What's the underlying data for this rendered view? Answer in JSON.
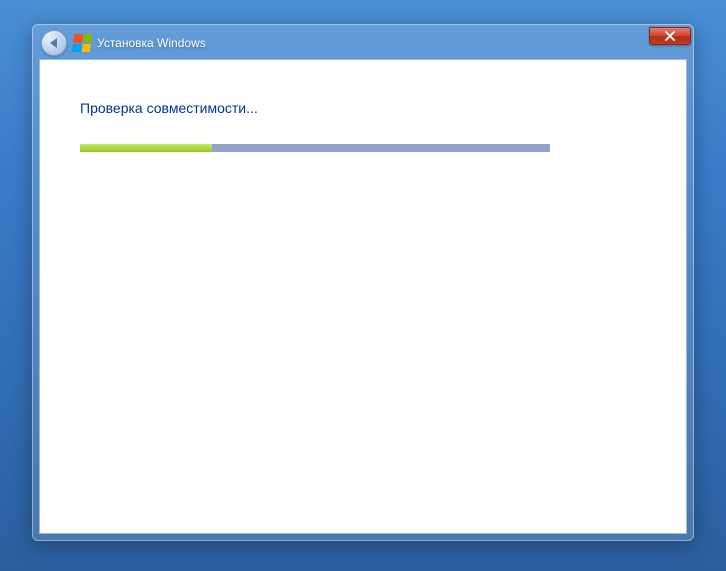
{
  "window": {
    "title": "Установка Windows"
  },
  "content": {
    "status_text": "Проверка совместимости..."
  },
  "progress": {
    "percent": 28
  },
  "colors": {
    "accent_blue": "#003399",
    "progress_green": "#8fc720",
    "progress_track": "#8fa4c8",
    "close_red": "#c23a22"
  }
}
